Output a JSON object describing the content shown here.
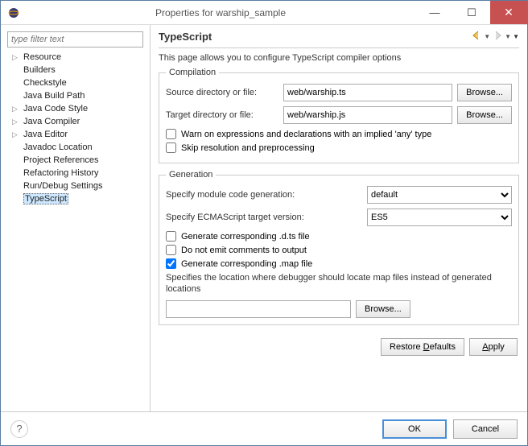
{
  "window": {
    "title": "Properties for warship_sample"
  },
  "filter": {
    "placeholder": "type filter text"
  },
  "tree": {
    "items": [
      {
        "label": "Resource",
        "expand": true
      },
      {
        "label": "Builders"
      },
      {
        "label": "Checkstyle"
      },
      {
        "label": "Java Build Path"
      },
      {
        "label": "Java Code Style",
        "expand": true
      },
      {
        "label": "Java Compiler",
        "expand": true
      },
      {
        "label": "Java Editor",
        "expand": true
      },
      {
        "label": "Javadoc Location"
      },
      {
        "label": "Project References"
      },
      {
        "label": "Refactoring History"
      },
      {
        "label": "Run/Debug Settings"
      },
      {
        "label": "TypeScript",
        "selected": true
      }
    ]
  },
  "page": {
    "title": "TypeScript",
    "description": "This page allows you to configure TypeScript compiler options"
  },
  "compilation": {
    "legend": "Compilation",
    "source_label": "Source directory or file:",
    "source_value": "web/warship.ts",
    "target_label": "Target directory or file:",
    "target_value": "web/warship.js",
    "browse": "Browse...",
    "warn_any": "Warn on expressions and declarations with an implied 'any' type",
    "skip_res": "Skip resolution and preprocessing"
  },
  "generation": {
    "legend": "Generation",
    "module_label": "Specify module code generation:",
    "module_value": "default",
    "ecma_label": "Specify ECMAScript target version:",
    "ecma_value": "ES5",
    "gen_dts": "Generate  corresponding .d.ts file",
    "no_comments": "Do not emit comments to output",
    "gen_map": "Generate  corresponding .map file",
    "map_desc": "Specifies the location where debugger should locate map files instead of generated locations",
    "map_value": "",
    "browse": "Browse..."
  },
  "buttons": {
    "restore": "Restore Defaults",
    "apply": "Apply",
    "ok": "OK",
    "cancel": "Cancel"
  }
}
